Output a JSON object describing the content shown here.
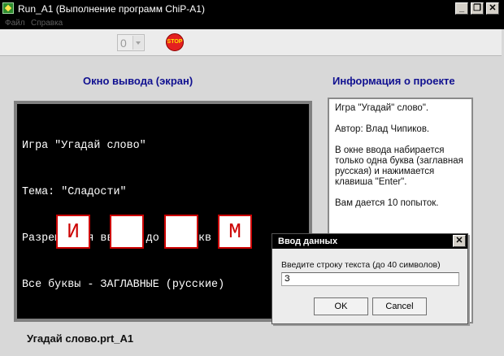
{
  "window": {
    "title": "Run_A1 (Выполнение программ ChiP-A1)",
    "minimize_glyph": "_",
    "restore_glyph": "❐",
    "close_glyph": "✕"
  },
  "menu": [
    {
      "label": "Файл"
    },
    {
      "label": "Справка"
    }
  ],
  "toolbar": {
    "speed_value": "0",
    "stop_label": "STOP"
  },
  "output_panel": {
    "title": "Окно вывода (экран)",
    "screen_lines": [
      "Игра \"Угадай слово\"",
      "Тема: \"Сладости\"",
      "Разрешается ввести до 10 букв",
      "Все буквы - ЗАГЛАВНЫЕ (русские)"
    ],
    "letter_cells": [
      "И",
      "",
      "",
      "М"
    ]
  },
  "info_panel": {
    "title": "Информация о проекте",
    "paragraphs": [
      "Игра \"Угадай\" слово\".",
      "Автор: Влад Чипиков.",
      "В окне ввода набирается только одна буква (заглавная русская) и нажимается клавиша \"Enter\".",
      "Вам дается 10 попыток."
    ]
  },
  "status": {
    "filename": "Угадай слово.prt_A1"
  },
  "dialog": {
    "title": "Ввод данных",
    "close_glyph": "✕",
    "prompt": "Введите строку текста (до 40 символов)",
    "input_value": "З",
    "ok_label": "OK",
    "cancel_label": "Cancel"
  },
  "colors": {
    "screen_bg": "#000000",
    "letter_cell_border": "#cc0000",
    "panel_title": "#101090",
    "stop_button": "#e42020"
  },
  "icons": {
    "app": "app-icon",
    "stop": "stop-icon",
    "dropdown": "chevron-down-icon"
  }
}
